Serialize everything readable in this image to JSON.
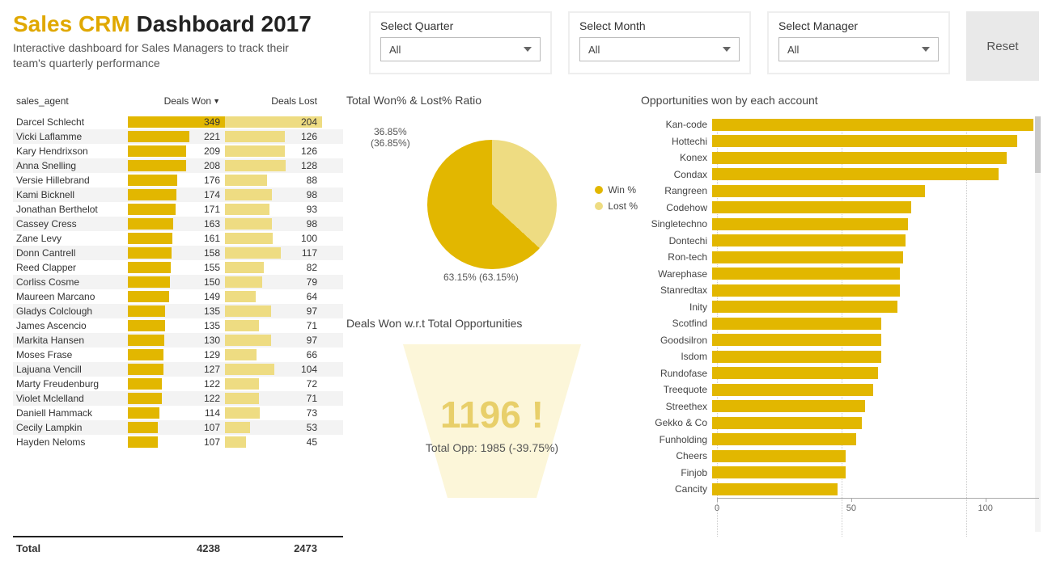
{
  "header": {
    "title_accent": "Sales CRM",
    "title_rest": "Dashboard 2017",
    "subtitle": "Interactive dashboard for Sales Managers to track their team's quarterly performance"
  },
  "filters": {
    "quarter": {
      "label": "Select Quarter",
      "value": "All"
    },
    "month": {
      "label": "Select Month",
      "value": "All"
    },
    "manager": {
      "label": "Select Manager",
      "value": "All"
    },
    "reset_label": "Reset"
  },
  "table": {
    "col_agent": "sales_agent",
    "col_won": "Deals Won",
    "col_lost": "Deals Lost",
    "total_label": "Total",
    "total_won": "4238",
    "total_lost": "2473",
    "rows": [
      {
        "agent": "Darcel Schlecht",
        "won": 349,
        "lost": 204
      },
      {
        "agent": "Vicki Laflamme",
        "won": 221,
        "lost": 126
      },
      {
        "agent": "Kary Hendrixson",
        "won": 209,
        "lost": 126
      },
      {
        "agent": "Anna Snelling",
        "won": 208,
        "lost": 128
      },
      {
        "agent": "Versie Hillebrand",
        "won": 176,
        "lost": 88
      },
      {
        "agent": "Kami Bicknell",
        "won": 174,
        "lost": 98
      },
      {
        "agent": "Jonathan Berthelot",
        "won": 171,
        "lost": 93
      },
      {
        "agent": "Cassey Cress",
        "won": 163,
        "lost": 98
      },
      {
        "agent": "Zane Levy",
        "won": 161,
        "lost": 100
      },
      {
        "agent": "Donn Cantrell",
        "won": 158,
        "lost": 117
      },
      {
        "agent": "Reed Clapper",
        "won": 155,
        "lost": 82
      },
      {
        "agent": "Corliss Cosme",
        "won": 150,
        "lost": 79
      },
      {
        "agent": "Maureen Marcano",
        "won": 149,
        "lost": 64
      },
      {
        "agent": "Gladys Colclough",
        "won": 135,
        "lost": 97
      },
      {
        "agent": "James Ascencio",
        "won": 135,
        "lost": 71
      },
      {
        "agent": "Markita Hansen",
        "won": 130,
        "lost": 97
      },
      {
        "agent": "Moses Frase",
        "won": 129,
        "lost": 66
      },
      {
        "agent": "Lajuana Vencill",
        "won": 127,
        "lost": 104
      },
      {
        "agent": "Marty Freudenburg",
        "won": 122,
        "lost": 72
      },
      {
        "agent": "Violet Mclelland",
        "won": 122,
        "lost": 71
      },
      {
        "agent": "Daniell Hammack",
        "won": 114,
        "lost": 73
      },
      {
        "agent": "Cecily Lampkin",
        "won": 107,
        "lost": 53
      },
      {
        "agent": "Hayden Neloms",
        "won": 107,
        "lost": 45
      }
    ]
  },
  "mid": {
    "pie_title": "Total Won% & Lost% Ratio",
    "pie_lost_label": "36.85%\n(36.85%)",
    "pie_won_label": "63.15% (63.15%)",
    "legend_win": "Win %",
    "legend_lost": "Lost %",
    "gauge_title": "Deals Won w.r.t Total Opportunities",
    "gauge_value": "1196 !",
    "gauge_sub": "Total Opp: 1985 (-39.75%)"
  },
  "right": {
    "title": "Opportunities won by each account",
    "axis_ticks": [
      "0",
      "50",
      "100"
    ],
    "rows": [
      {
        "account": "Kan-code",
        "value": 118
      },
      {
        "account": "Hottechi",
        "value": 112
      },
      {
        "account": "Konex",
        "value": 108
      },
      {
        "account": "Condax",
        "value": 105
      },
      {
        "account": "Rangreen",
        "value": 78
      },
      {
        "account": "Codehow",
        "value": 73
      },
      {
        "account": "Singletechno",
        "value": 72
      },
      {
        "account": "Dontechi",
        "value": 71
      },
      {
        "account": "Ron-tech",
        "value": 70
      },
      {
        "account": "Warephase",
        "value": 69
      },
      {
        "account": "Stanredtax",
        "value": 69
      },
      {
        "account": "Inity",
        "value": 68
      },
      {
        "account": "Scotfind",
        "value": 62
      },
      {
        "account": "Goodsilron",
        "value": 62
      },
      {
        "account": "Isdom",
        "value": 62
      },
      {
        "account": "Rundofase",
        "value": 61
      },
      {
        "account": "Treequote",
        "value": 59
      },
      {
        "account": "Streethex",
        "value": 56
      },
      {
        "account": "Gekko & Co",
        "value": 55
      },
      {
        "account": "Funholding",
        "value": 53
      },
      {
        "account": "Cheers",
        "value": 49
      },
      {
        "account": "Finjob",
        "value": 49
      },
      {
        "account": "Cancity",
        "value": 46
      }
    ]
  },
  "chart_data": [
    {
      "type": "table",
      "title": "Deals Won / Lost by sales agent",
      "columns": [
        "sales_agent",
        "Deals Won",
        "Deals Lost"
      ],
      "rows": [
        [
          "Darcel Schlecht",
          349,
          204
        ],
        [
          "Vicki Laflamme",
          221,
          126
        ],
        [
          "Kary Hendrixson",
          209,
          126
        ],
        [
          "Anna Snelling",
          208,
          128
        ],
        [
          "Versie Hillebrand",
          176,
          88
        ],
        [
          "Kami Bicknell",
          174,
          98
        ],
        [
          "Jonathan Berthelot",
          171,
          93
        ],
        [
          "Cassey Cress",
          163,
          98
        ],
        [
          "Zane Levy",
          161,
          100
        ],
        [
          "Donn Cantrell",
          158,
          117
        ],
        [
          "Reed Clapper",
          155,
          82
        ],
        [
          "Corliss Cosme",
          150,
          79
        ],
        [
          "Maureen Marcano",
          149,
          64
        ],
        [
          "Gladys Colclough",
          135,
          97
        ],
        [
          "James Ascencio",
          135,
          71
        ],
        [
          "Markita Hansen",
          130,
          97
        ],
        [
          "Moses Frase",
          129,
          66
        ],
        [
          "Lajuana Vencill",
          127,
          104
        ],
        [
          "Marty Freudenburg",
          122,
          72
        ],
        [
          "Violet Mclelland",
          122,
          71
        ],
        [
          "Daniell Hammack",
          114,
          73
        ],
        [
          "Cecily Lampkin",
          107,
          53
        ],
        [
          "Hayden Neloms",
          107,
          45
        ]
      ],
      "totals": {
        "Deals Won": 4238,
        "Deals Lost": 2473
      }
    },
    {
      "type": "pie",
      "title": "Total Won% & Lost% Ratio",
      "series": [
        {
          "name": "Win %",
          "value": 63.15
        },
        {
          "name": "Lost %",
          "value": 36.85
        }
      ]
    },
    {
      "type": "bar",
      "title": "Opportunities won by each account",
      "categories": [
        "Kan-code",
        "Hottechi",
        "Konex",
        "Condax",
        "Rangreen",
        "Codehow",
        "Singletechno",
        "Dontechi",
        "Ron-tech",
        "Warephase",
        "Stanredtax",
        "Inity",
        "Scotfind",
        "Goodsilron",
        "Isdom",
        "Rundofase",
        "Treequote",
        "Streethex",
        "Gekko & Co",
        "Funholding",
        "Cheers",
        "Finjob",
        "Cancity"
      ],
      "values": [
        118,
        112,
        108,
        105,
        78,
        73,
        72,
        71,
        70,
        69,
        69,
        68,
        62,
        62,
        62,
        61,
        59,
        56,
        55,
        53,
        49,
        49,
        46
      ],
      "xlim": [
        0,
        120
      ],
      "xlabel": "",
      "ylabel": ""
    },
    {
      "type": "gauge",
      "title": "Deals Won w.r.t Total Opportunities",
      "value": 1196,
      "target": 1985,
      "delta_pct": -39.75
    }
  ]
}
